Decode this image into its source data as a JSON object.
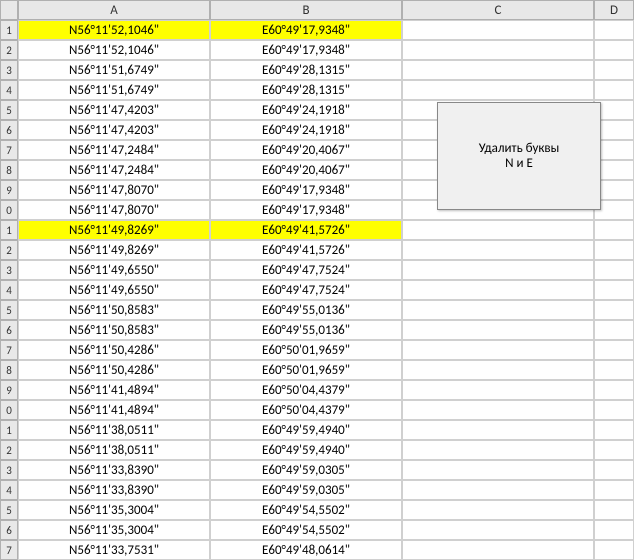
{
  "columns": [
    "A",
    "B",
    "C",
    "D"
  ],
  "rows": [
    {
      "n": "1",
      "a": "N56°11'52,1046\"",
      "b": "E60°49'17,9348\"",
      "hl": true
    },
    {
      "n": "2",
      "a": "N56°11'52,1046\"",
      "b": "E60°49'17,9348\"",
      "hl": false
    },
    {
      "n": "3",
      "a": "N56°11'51,6749\"",
      "b": "E60°49'28,1315\"",
      "hl": false
    },
    {
      "n": "4",
      "a": "N56°11'51,6749\"",
      "b": "E60°49'28,1315\"",
      "hl": false
    },
    {
      "n": "5",
      "a": "N56°11'47,4203\"",
      "b": "E60°49'24,1918\"",
      "hl": false
    },
    {
      "n": "6",
      "a": "N56°11'47,4203\"",
      "b": "E60°49'24,1918\"",
      "hl": false
    },
    {
      "n": "7",
      "a": "N56°11'47,2484\"",
      "b": "E60°49'20,4067\"",
      "hl": false
    },
    {
      "n": "8",
      "a": "N56°11'47,2484\"",
      "b": "E60°49'20,4067\"",
      "hl": false
    },
    {
      "n": "9",
      "a": "N56°11'47,8070\"",
      "b": "E60°49'17,9348\"",
      "hl": false
    },
    {
      "n": "0",
      "a": "N56°11'47,8070\"",
      "b": "E60°49'17,9348\"",
      "hl": false
    },
    {
      "n": "1",
      "a": "N56°11'49,8269\"",
      "b": "E60°49'41,5726\"",
      "hl": true
    },
    {
      "n": "2",
      "a": "N56°11'49,8269\"",
      "b": "E60°49'41,5726\"",
      "hl": false
    },
    {
      "n": "3",
      "a": "N56°11'49,6550\"",
      "b": "E60°49'47,7524\"",
      "hl": false
    },
    {
      "n": "4",
      "a": "N56°11'49,6550\"",
      "b": "E60°49'47,7524\"",
      "hl": false
    },
    {
      "n": "5",
      "a": "N56°11'50,8583\"",
      "b": "E60°49'55,0136\"",
      "hl": false
    },
    {
      "n": "6",
      "a": "N56°11'50,8583\"",
      "b": "E60°49'55,0136\"",
      "hl": false
    },
    {
      "n": "7",
      "a": "N56°11'50,4286\"",
      "b": "E60°50'01,9659\"",
      "hl": false
    },
    {
      "n": "8",
      "a": "N56°11'50,4286\"",
      "b": "E60°50'01,9659\"",
      "hl": false
    },
    {
      "n": "9",
      "a": "N56°11'41,4894\"",
      "b": "E60°50'04,4379\"",
      "hl": false
    },
    {
      "n": "0",
      "a": "N56°11'41,4894\"",
      "b": "E60°50'04,4379\"",
      "hl": false
    },
    {
      "n": "1",
      "a": "N56°11'38,0511\"",
      "b": "E60°49'59,4940\"",
      "hl": false
    },
    {
      "n": "2",
      "a": "N56°11'38,0511\"",
      "b": "E60°49'59,4940\"",
      "hl": false
    },
    {
      "n": "3",
      "a": "N56°11'33,8390\"",
      "b": "E60°49'59,0305\"",
      "hl": false
    },
    {
      "n": "4",
      "a": "N56°11'33,8390\"",
      "b": "E60°49'59,0305\"",
      "hl": false
    },
    {
      "n": "5",
      "a": "N56°11'35,3004\"",
      "b": "E60°49'54,5502\"",
      "hl": false
    },
    {
      "n": "6",
      "a": "N56°11'35,3004\"",
      "b": "E60°49'54,5502\"",
      "hl": false
    },
    {
      "n": "7",
      "a": "N56°11'33,7531\"",
      "b": "E60°49'48,0614\"",
      "hl": false
    }
  ],
  "button": {
    "label": "Удалить буквы\nN и E"
  }
}
